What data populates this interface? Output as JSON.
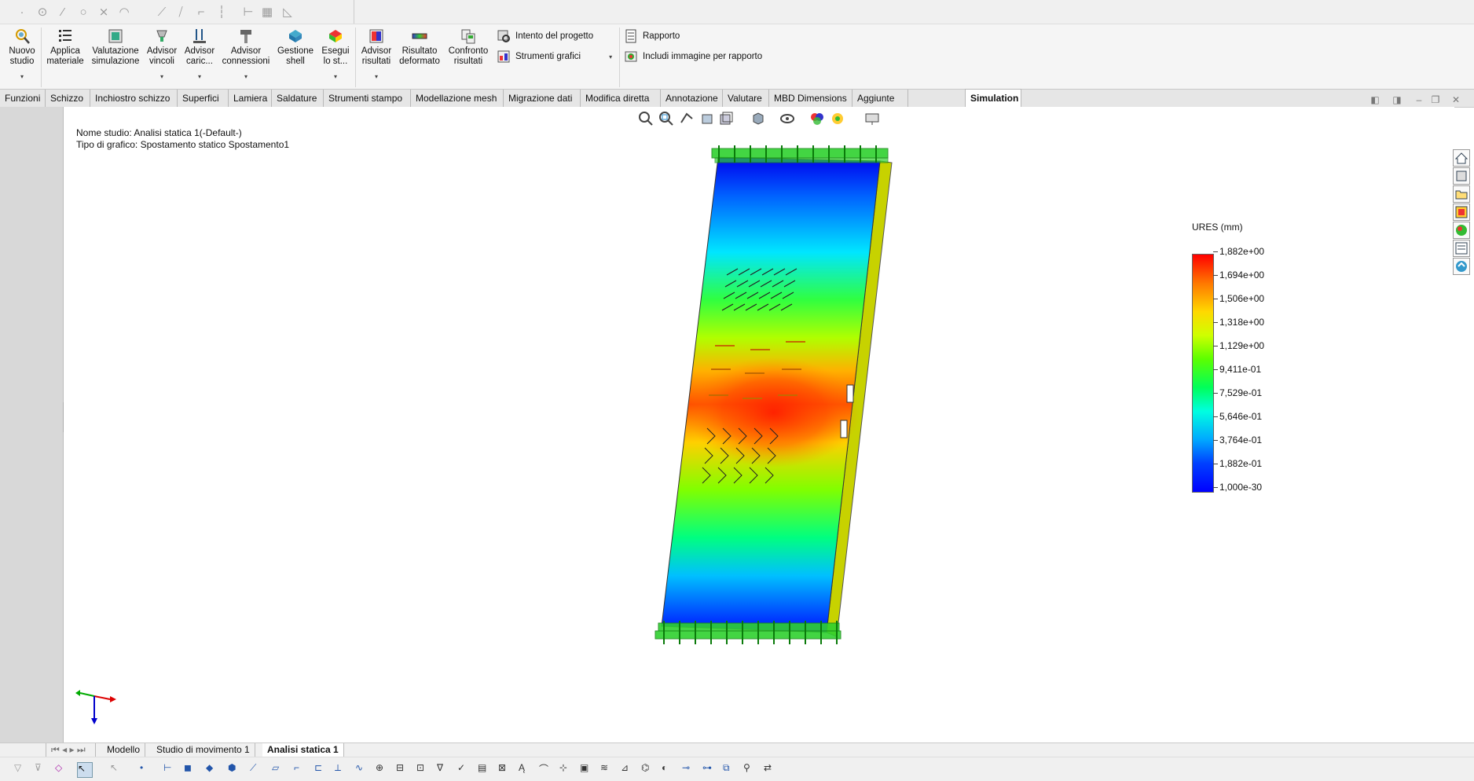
{
  "ribbon": {
    "buttons": [
      {
        "label": "Nuovo\nstudio",
        "has_arrow": true
      },
      {
        "label": "Applica\nmateriale",
        "has_arrow": false
      },
      {
        "label": "Valutazione\nsimulazione",
        "has_arrow": false
      },
      {
        "label": "Advisor\nvincoli",
        "has_arrow": true
      },
      {
        "label": "Advisor\ncaric...",
        "has_arrow": true
      },
      {
        "label": "Advisor\nconnessioni",
        "has_arrow": true
      },
      {
        "label": "Gestione\nshell",
        "has_arrow": false
      },
      {
        "label": "Esegui\nlo st...",
        "has_arrow": true
      },
      {
        "label": "Advisor\nrisultati",
        "has_arrow": true
      },
      {
        "label": "Risultato\ndeformato",
        "has_arrow": false
      },
      {
        "label": "Confronto\nrisultati",
        "has_arrow": false
      }
    ],
    "small": [
      {
        "label": "Intento del progetto"
      },
      {
        "label": "Strumenti grafici"
      },
      {
        "label": "Rapporto"
      },
      {
        "label": "Includi immagine per rapporto"
      }
    ]
  },
  "tabs": [
    "Funzioni",
    "Schizzo",
    "Inchiostro schizzo",
    "Superfici",
    "Lamiera",
    "Saldature",
    "Strumenti stampo",
    "Modellazione mesh",
    "Migrazione dati",
    "Modifica diretta",
    "Annotazione",
    "Valutare",
    "MBD Dimensions",
    "Aggiunte",
    "Simulation"
  ],
  "active_tab": "Simulation",
  "viewport": {
    "study_name": "Nome studio: Analisi statica 1(-Default-)",
    "plot_type": "Tipo di grafico: Spostamento statico Spostamento1"
  },
  "legend": {
    "title": "URES (mm)",
    "labels": [
      "1,882e+00",
      "1,694e+00",
      "1,506e+00",
      "1,318e+00",
      "1,129e+00",
      "9,411e-01",
      "7,529e-01",
      "5,646e-01",
      "3,764e-01",
      "1,882e-01",
      "1,000e-30"
    ],
    "colors": [
      "#ff0000",
      "#ff7700",
      "#ffd800",
      "#cfff00",
      "#5cff00",
      "#00ff5a",
      "#00ffe0",
      "#00a8ff",
      "#0040ff",
      "#0000ff"
    ]
  },
  "bottom_tabs": [
    "Modello",
    "Studio di movimento 1",
    "Analisi statica 1"
  ],
  "bottom_active": "Analisi statica 1"
}
